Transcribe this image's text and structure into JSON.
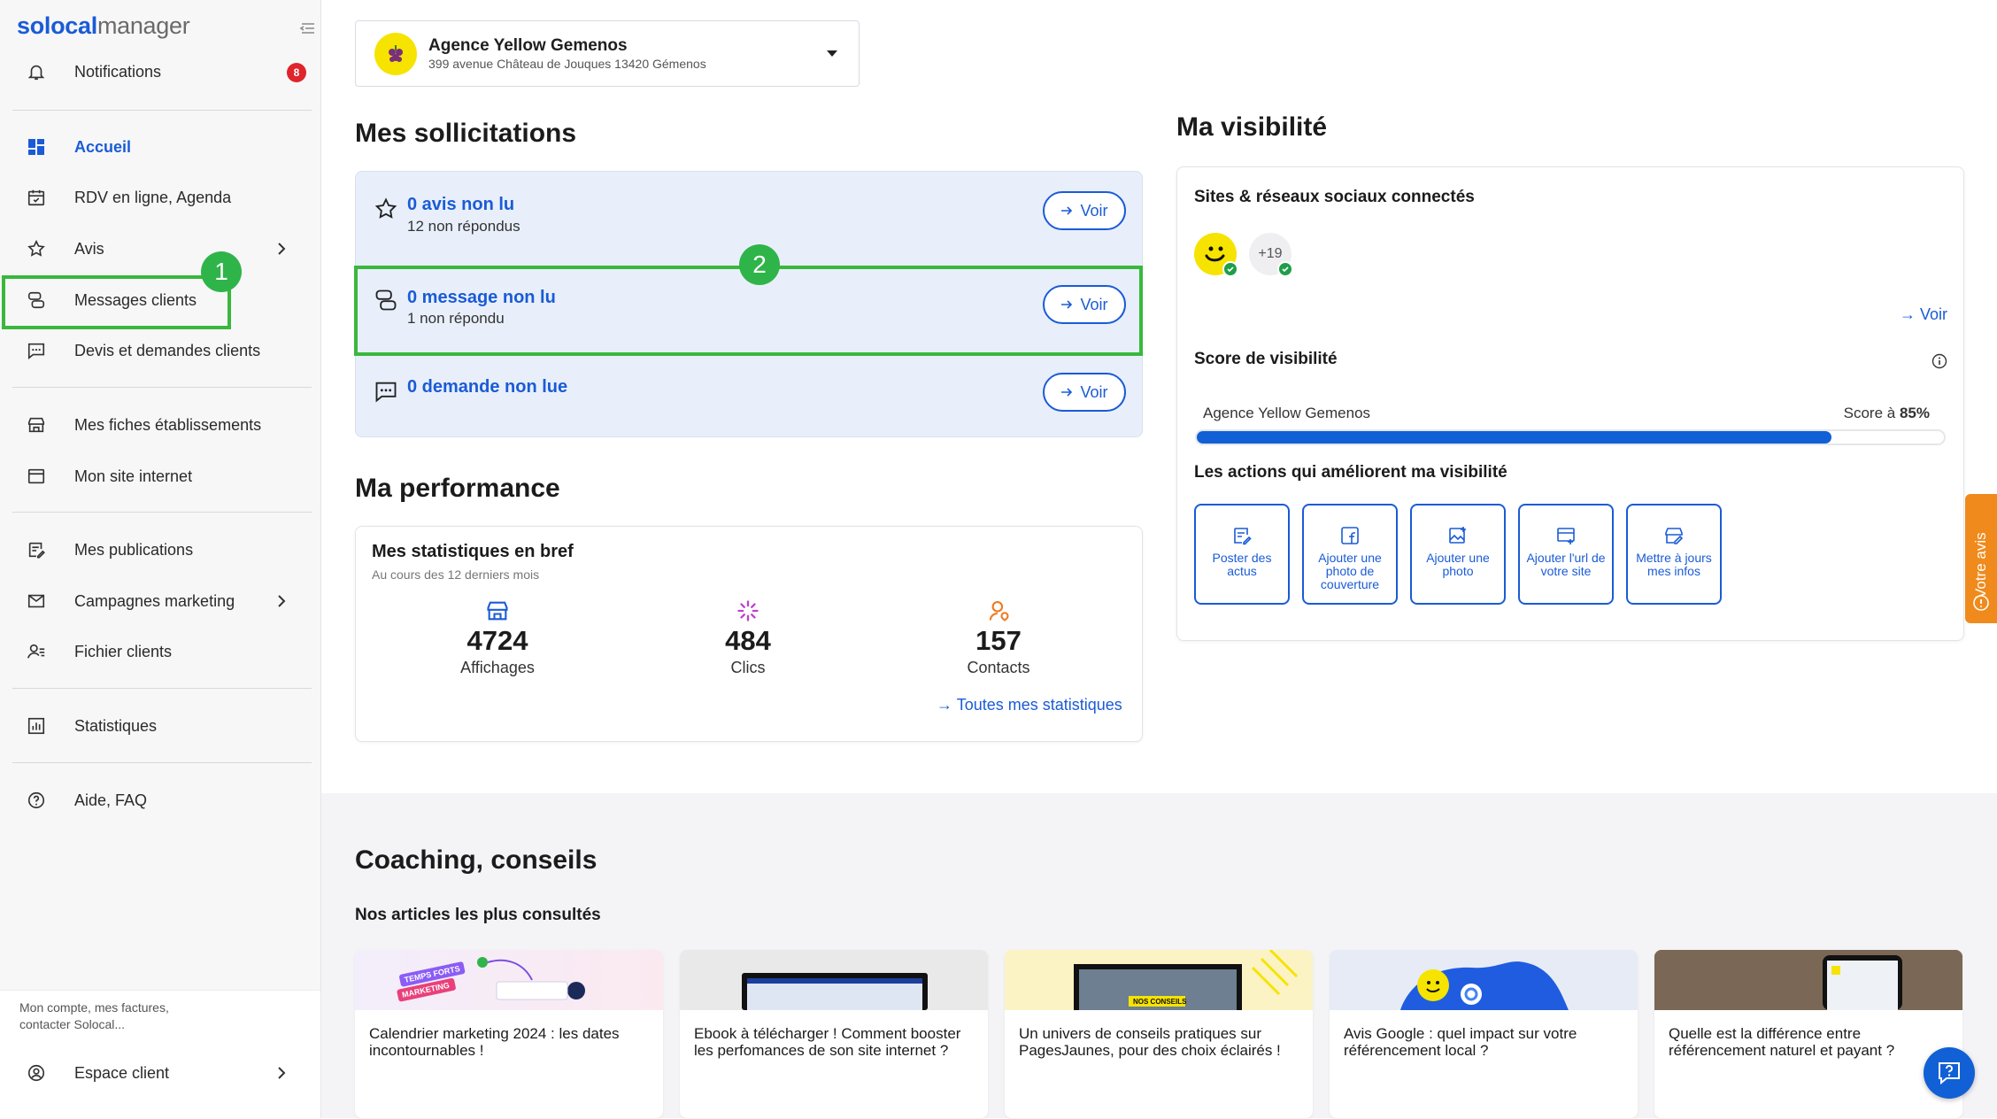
{
  "brand": {
    "logo_a": "solocal",
    "logo_b": "manager"
  },
  "sidebar": {
    "notifications": {
      "label": "Notifications",
      "count": "8"
    },
    "items": [
      {
        "label": "Accueil",
        "icon": "dashboard-icon"
      },
      {
        "label": "RDV en ligne, Agenda",
        "icon": "calendar-icon"
      },
      {
        "label": "Avis",
        "icon": "star-icon"
      },
      {
        "label": "Messages clients",
        "icon": "chat-icon"
      },
      {
        "label": "Devis et demandes clients",
        "icon": "request-icon"
      },
      {
        "label": "Mes fiches établissements",
        "icon": "store-icon"
      },
      {
        "label": "Mon site internet",
        "icon": "website-icon"
      },
      {
        "label": "Mes publications",
        "icon": "edit-icon"
      },
      {
        "label": "Campagnes marketing",
        "icon": "mail-icon"
      },
      {
        "label": "Fichier clients",
        "icon": "contacts-icon"
      },
      {
        "label": "Statistiques",
        "icon": "stats-icon"
      },
      {
        "label": "Aide, FAQ",
        "icon": "help-icon"
      }
    ],
    "account_text": "Mon compte, mes factures, contacter Solocal...",
    "espace_client": "Espace client"
  },
  "annotations": {
    "step1": "1",
    "step2": "2"
  },
  "establishment": {
    "name": "Agence Yellow Gemenos",
    "address": "399 avenue Château de Jouques 13420 Gémenos"
  },
  "sollicitations": {
    "title": "Mes sollicitations",
    "rows": [
      {
        "title": "0 avis non lu",
        "sub": "12 non répondus",
        "button": "Voir"
      },
      {
        "title": "0 message non lu",
        "sub": "1 non répondu",
        "button": "Voir"
      },
      {
        "title": "0 demande non lue",
        "sub": "",
        "button": "Voir"
      }
    ]
  },
  "performance": {
    "title": "Ma performance",
    "card_title": "Mes statistiques en bref",
    "card_sub": "Au cours des 12 derniers mois",
    "stats": [
      {
        "value": "4724",
        "label": "Affichages"
      },
      {
        "value": "484",
        "label": "Clics"
      },
      {
        "value": "157",
        "label": "Contacts"
      }
    ],
    "link": "Toutes mes statistiques"
  },
  "visibilite": {
    "title": "Ma visibilité",
    "sites_title": "Sites & réseaux sociaux connectés",
    "more_count": "+19",
    "voir": "Voir",
    "score_title": "Score de visibilité",
    "score_name": "Agence Yellow Gemenos",
    "score_prefix": "Score à",
    "score_value": "85%",
    "score_fraction": 0.85,
    "actions_title": "Les actions qui améliorent ma visibilité",
    "actions": [
      "Poster des actus",
      "Ajouter une photo de couverture",
      "Ajouter une photo",
      "Ajouter l'url de votre site",
      "Mettre à jours mes infos"
    ]
  },
  "feedback_tab": "Votre avis",
  "coaching": {
    "title": "Coaching, conseils",
    "subtitle": "Nos articles les plus consultés",
    "articles": [
      "Calendrier marketing 2024 : les dates incontournables !",
      "Ebook à télécharger ! Comment booster les perfomances de son site internet ?",
      "Un univers de conseils pratiques sur PagesJaunes, pour des choix éclairés !",
      "Avis Google : quel impact sur votre référencement local ?",
      "Quelle est la différence entre référencement naturel et payant ?"
    ],
    "image_text": {
      "tag1": "TEMPS FORTS",
      "tag2": "MARKETING",
      "tag3": "NOS CONSEILS"
    }
  },
  "colors": {
    "accent": "#1a5bd6",
    "annotation_green": "#2fb44a",
    "badge_red": "#e0242c",
    "feedback_orange": "#f08a1c"
  }
}
